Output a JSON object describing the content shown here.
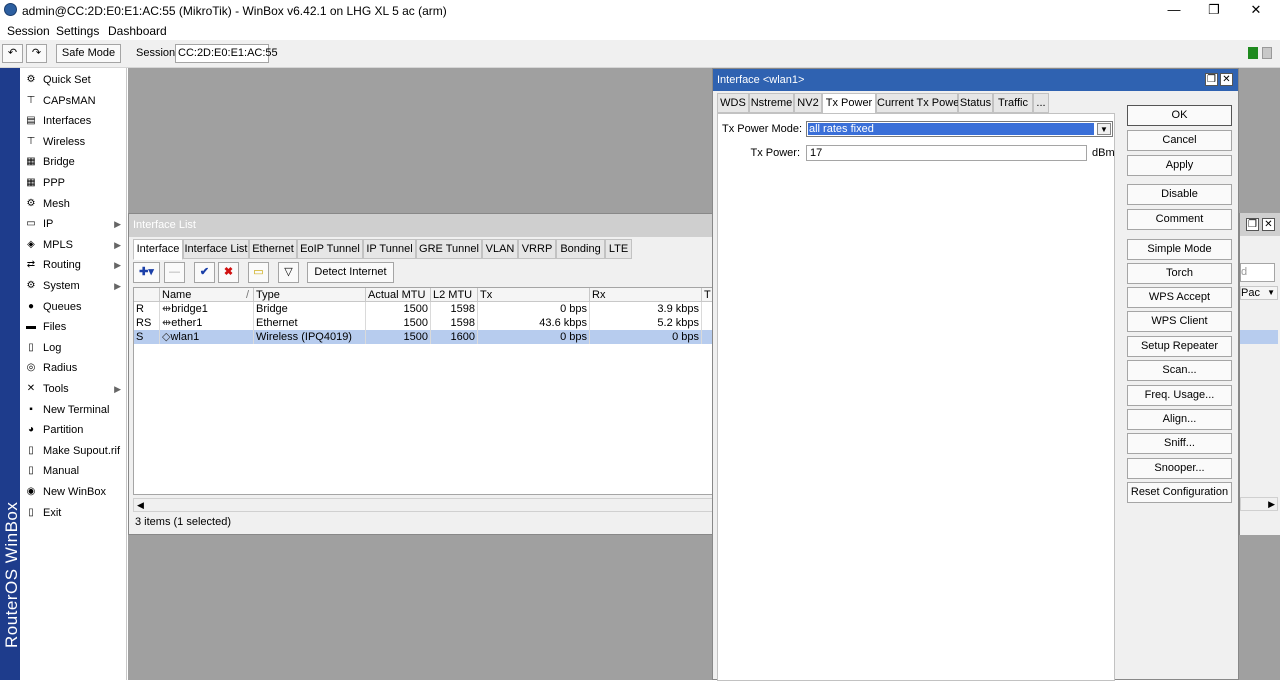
{
  "window": {
    "title": "admin@CC:2D:E0:E1:AC:55 (MikroTik) - WinBox v6.42.1 on LHG XL 5 ac (arm)",
    "minimize": "—",
    "maximize": "❐",
    "close": "✕"
  },
  "menu": [
    "Session",
    "Settings",
    "Dashboard"
  ],
  "toolbar": {
    "undo": "↶",
    "redo": "↷",
    "safe_mode": "Safe Mode",
    "session_label": "Session:",
    "session_value": "CC:2D:E0:E1:AC:55"
  },
  "brand": "RouterOS WinBox",
  "sidebar": [
    {
      "label": "Quick Set",
      "icon": "quick-set-icon",
      "glyph": "⚙"
    },
    {
      "label": "CAPsMAN",
      "icon": "capsman-icon",
      "glyph": "⊤"
    },
    {
      "label": "Interfaces",
      "icon": "interfaces-icon",
      "glyph": "▤"
    },
    {
      "label": "Wireless",
      "icon": "wireless-icon",
      "glyph": "⊤"
    },
    {
      "label": "Bridge",
      "icon": "bridge-icon",
      "glyph": "▦"
    },
    {
      "label": "PPP",
      "icon": "ppp-icon",
      "glyph": "▦"
    },
    {
      "label": "Mesh",
      "icon": "mesh-icon",
      "glyph": "⚙"
    },
    {
      "label": "IP",
      "icon": "ip-icon",
      "glyph": "▭",
      "arrow": "▶"
    },
    {
      "label": "MPLS",
      "icon": "mpls-icon",
      "glyph": "◈",
      "arrow": "▶"
    },
    {
      "label": "Routing",
      "icon": "routing-icon",
      "glyph": "⇄",
      "arrow": "▶"
    },
    {
      "label": "System",
      "icon": "system-icon",
      "glyph": "⚙",
      "arrow": "▶"
    },
    {
      "label": "Queues",
      "icon": "queues-icon",
      "glyph": "●"
    },
    {
      "label": "Files",
      "icon": "files-icon",
      "glyph": "▬"
    },
    {
      "label": "Log",
      "icon": "log-icon",
      "glyph": "▯"
    },
    {
      "label": "Radius",
      "icon": "radius-icon",
      "glyph": "◎"
    },
    {
      "label": "Tools",
      "icon": "tools-icon",
      "glyph": "✕",
      "arrow": "▶"
    },
    {
      "label": "New Terminal",
      "icon": "terminal-icon",
      "glyph": "▪"
    },
    {
      "label": "Partition",
      "icon": "partition-icon",
      "glyph": "◕"
    },
    {
      "label": "Make Supout.rif",
      "icon": "supout-icon",
      "glyph": "▯"
    },
    {
      "label": "Manual",
      "icon": "manual-icon",
      "glyph": "▯"
    },
    {
      "label": "New WinBox",
      "icon": "winbox-icon",
      "glyph": "◉"
    },
    {
      "label": "Exit",
      "icon": "exit-icon",
      "glyph": "▯"
    }
  ],
  "interface_list": {
    "title": "Interface List",
    "tabs": [
      "Interface",
      "Interface List",
      "Ethernet",
      "EoIP Tunnel",
      "IP Tunnel",
      "GRE Tunnel",
      "VLAN",
      "VRRP",
      "Bonding",
      "LTE"
    ],
    "buttons": {
      "add": "✚▾",
      "remove": "—",
      "enable": "✔",
      "disable": "✖",
      "comment": "▭",
      "filter": "▽",
      "detect": "Detect Internet"
    },
    "columns": [
      "",
      "Name",
      "Type",
      "Actual MTU",
      "L2 MTU",
      "Tx",
      "Rx",
      "T"
    ],
    "rows": [
      {
        "flag": "R",
        "name": "bridge1",
        "icon": "⇹",
        "type": "Bridge",
        "mtu": "1500",
        "l2mtu": "1598",
        "tx": "0 bps",
        "rx": "3.9 kbps"
      },
      {
        "flag": "RS",
        "name": "ether1",
        "icon": "⇹",
        "type": "Ethernet",
        "mtu": "1500",
        "l2mtu": "1598",
        "tx": "43.6 kbps",
        "rx": "5.2 kbps"
      },
      {
        "flag": "S",
        "name": "wlan1",
        "icon": "◇",
        "type": "Wireless (IPQ4019)",
        "mtu": "1500",
        "l2mtu": "1600",
        "tx": "0 bps",
        "rx": "0 bps"
      }
    ],
    "selected_row": 2,
    "status": "3 items (1 selected)",
    "scroll_left": "◀",
    "sort": "/"
  },
  "wlan_window": {
    "title": "Interface <wlan1>",
    "tabs": [
      "WDS",
      "Nstreme",
      "NV2",
      "Tx Power",
      "Current Tx Power",
      "Status",
      "Traffic",
      "..."
    ],
    "active_tab": 3,
    "tx_power_mode_label": "Tx Power Mode:",
    "tx_power_mode_value": "all rates fixed",
    "tx_power_label": "Tx Power:",
    "tx_power_value": "17",
    "tx_power_unit": "dBm",
    "actions": [
      "OK",
      "Cancel",
      "Apply",
      "Disable",
      "Comment",
      "Simple Mode",
      "Torch",
      "WPS Accept",
      "WPS Client",
      "Setup Repeater",
      "Scan...",
      "Freq. Usage...",
      "Align...",
      "Sniff...",
      "Snooper...",
      "Reset Configuration"
    ]
  },
  "right_window": {
    "partial_text": "d",
    "column": "Pac",
    "scroll": "▶"
  },
  "colors": {
    "accent_title": "#2f62b1",
    "brand_strip": "#1e3c8c",
    "selection": "#b7ccee",
    "desktop": "#a0a0a0"
  }
}
